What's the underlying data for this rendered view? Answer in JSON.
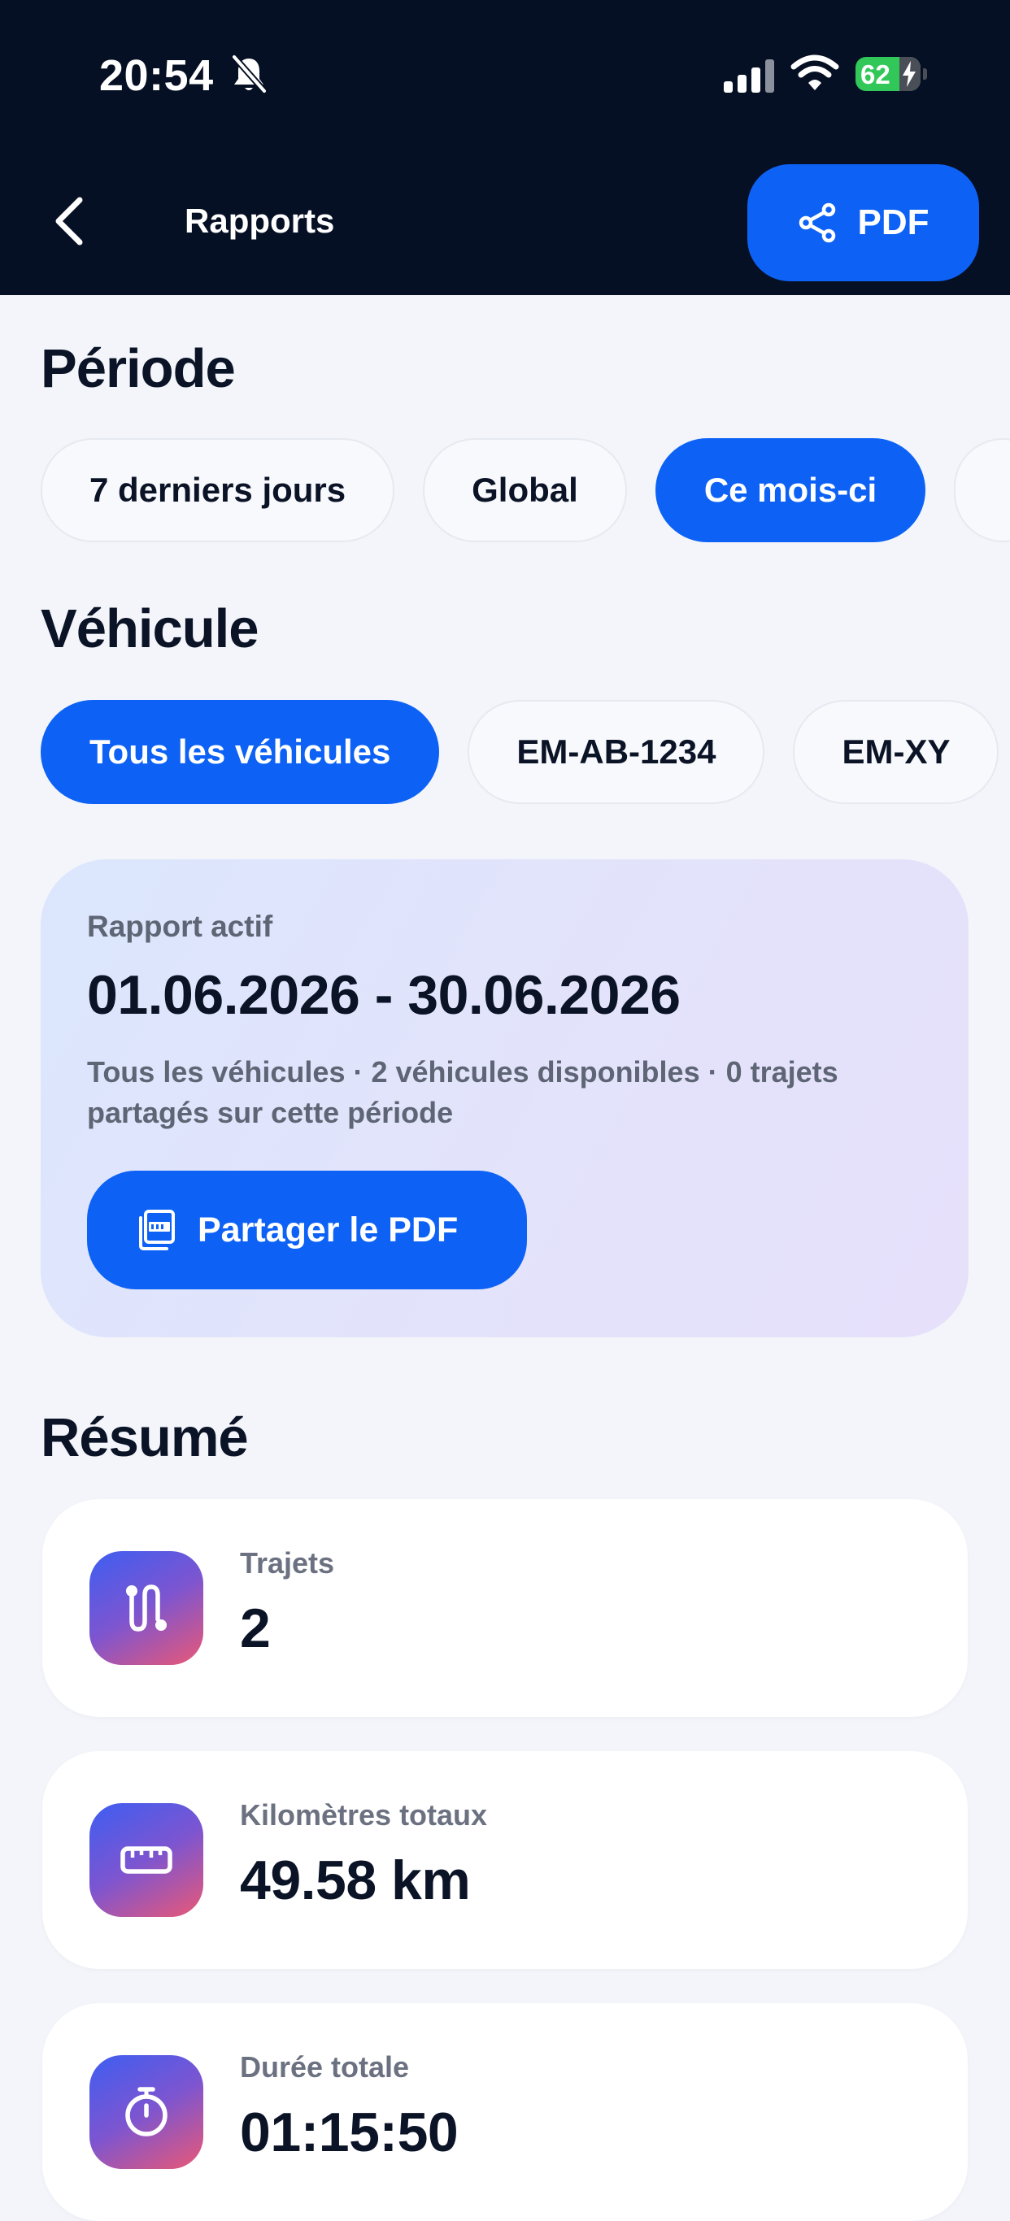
{
  "status_bar": {
    "time": "20:54",
    "battery": "62"
  },
  "nav": {
    "title": "Rapports",
    "pdf_button": "PDF"
  },
  "periode": {
    "title": "Période",
    "chips": [
      "7 derniers jours",
      "Global",
      "Ce mois-ci"
    ],
    "selected": "Ce mois-ci"
  },
  "vehicule": {
    "title": "Véhicule",
    "chips": [
      "Tous les véhicules",
      "EM-AB-1234",
      "EM-XY"
    ],
    "selected": "Tous les véhicules"
  },
  "report": {
    "label": "Rapport actif",
    "range": "01.06.2026 - 30.06.2026",
    "description": "Tous les véhicules · 2 véhicules disponibles · 0 trajets partagés sur cette période",
    "share_button": "Partager le PDF"
  },
  "resume": {
    "title": "Résumé",
    "stats": [
      {
        "label": "Trajets",
        "value": "2",
        "icon": "route-icon"
      },
      {
        "label": "Kilomètres totaux",
        "value": "49.58 km",
        "icon": "ruler-icon"
      },
      {
        "label": "Durée totale",
        "value": "01:15:50",
        "icon": "stopwatch-icon"
      }
    ]
  },
  "colors": {
    "header_bg": "#061024",
    "accent": "#0d62f5",
    "page_bg": "#f3f5fa",
    "battery": "#32c759"
  }
}
